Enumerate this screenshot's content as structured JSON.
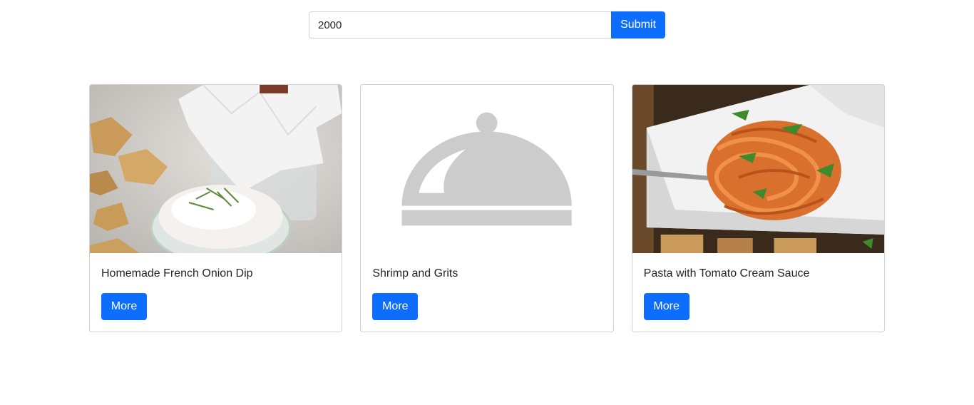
{
  "search": {
    "value": "2000",
    "submit_label": "Submit"
  },
  "recipes": [
    {
      "title": "Homemade French Onion Dip",
      "image": "french-onion-dip-photo",
      "more_label": "More"
    },
    {
      "title": "Shrimp and Grits",
      "image": "cloche-placeholder-icon",
      "more_label": "More"
    },
    {
      "title": "Pasta with Tomato Cream Sauce",
      "image": "pasta-tomato-cream-photo",
      "more_label": "More"
    }
  ],
  "colors": {
    "primary": "#0d6efd",
    "placeholder_gray": "#cccccc"
  }
}
